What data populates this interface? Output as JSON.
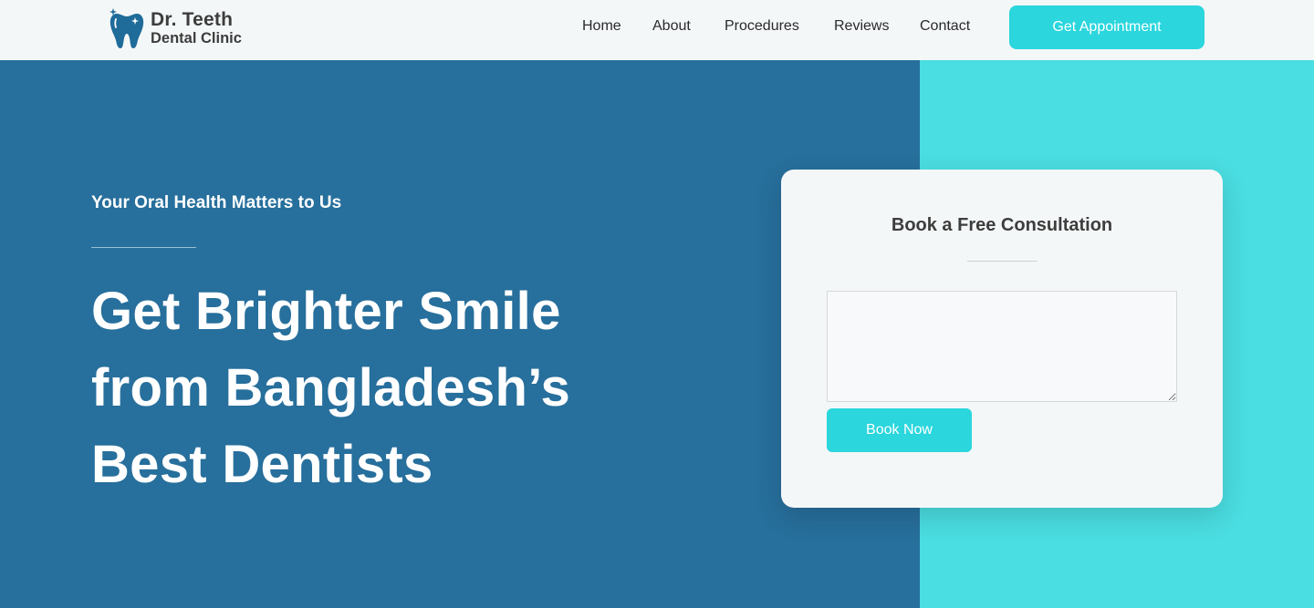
{
  "header": {
    "logo": {
      "line1": "Dr. Teeth",
      "line2": "Dental Clinic",
      "icon": "tooth-icon",
      "icon_color": "#1f6b9a"
    },
    "nav": [
      {
        "label": "Home"
      },
      {
        "label": "About"
      },
      {
        "label": "Procedures"
      },
      {
        "label": "Reviews"
      },
      {
        "label": "Contact"
      }
    ],
    "cta_label": "Get Appointment"
  },
  "hero": {
    "tagline": "Your Oral Health Matters to Us",
    "headline_lines": [
      "Get Brighter Smile",
      "from Bangladesh’s",
      "Best Dentists"
    ]
  },
  "consultation": {
    "title": "Book a Free Consultation",
    "textarea_value": "",
    "button_label": "Book Now"
  },
  "colors": {
    "header_bg": "#f4f7f8",
    "hero_blue": "#276f9c",
    "hero_cyan": "#4adde1",
    "accent": "#2bd6dd",
    "card_bg": "#f4f7f8",
    "text_dark": "#3d3d3d"
  }
}
